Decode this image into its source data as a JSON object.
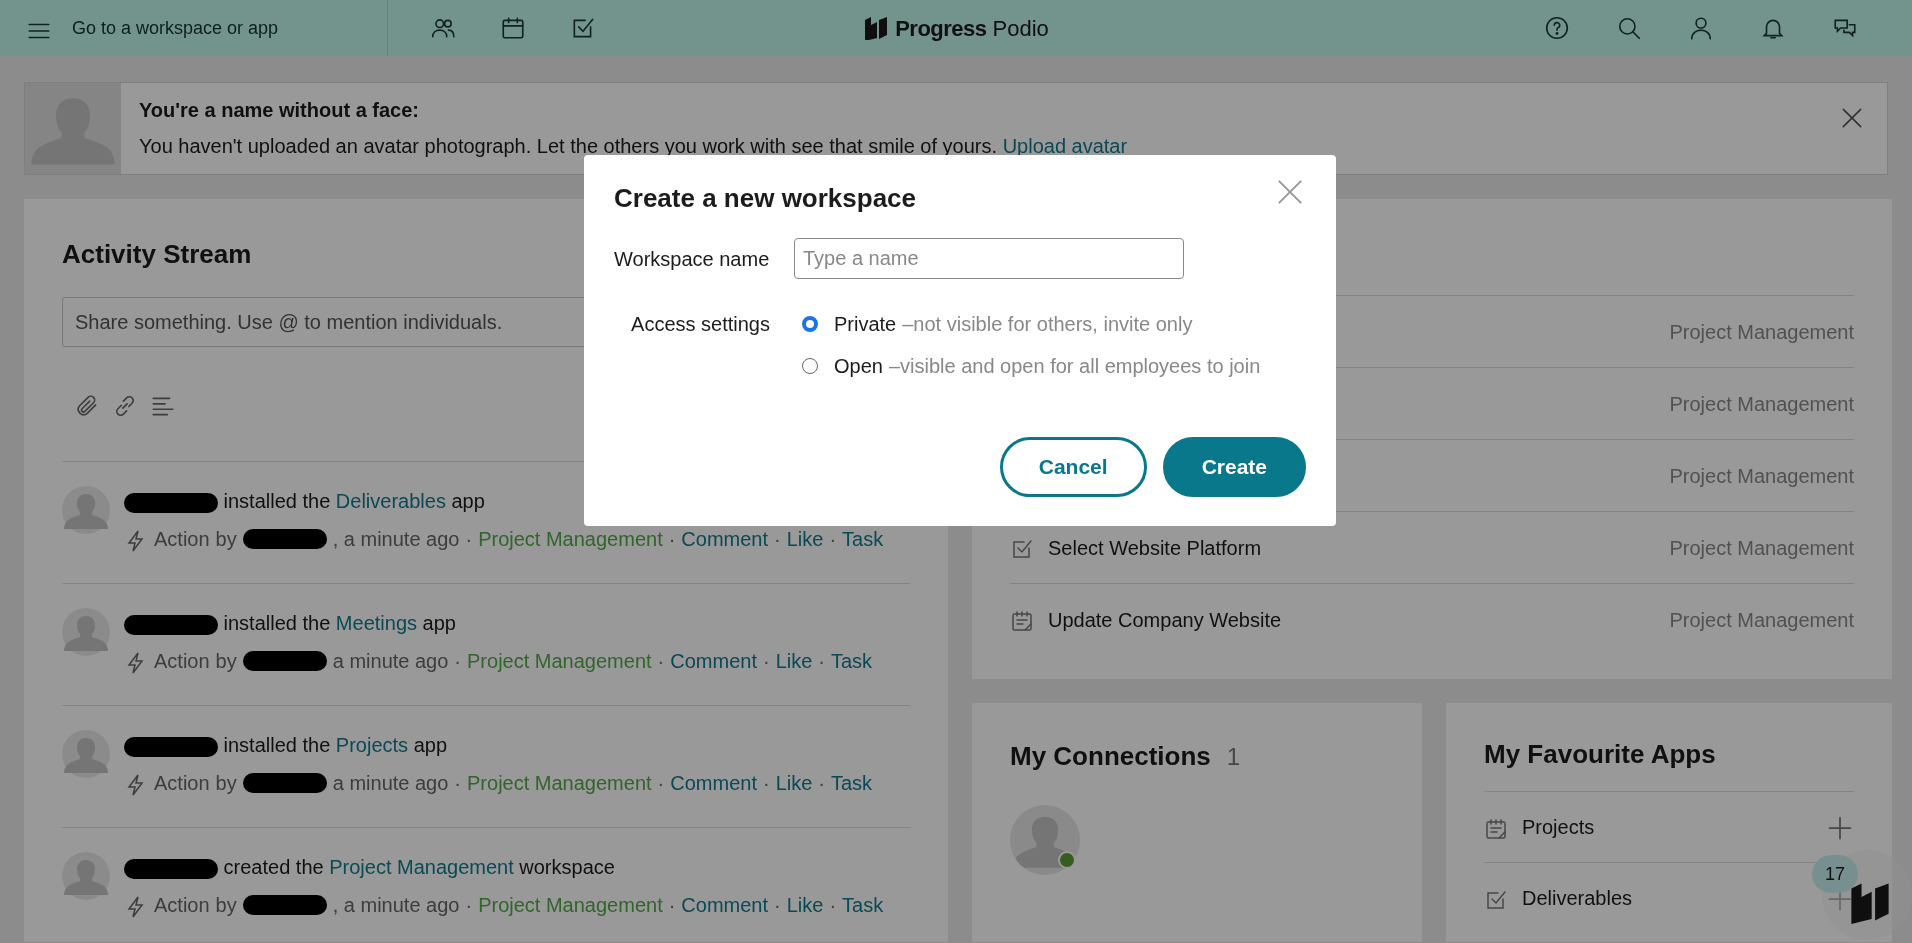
{
  "topbar": {
    "search_label": "Go to a workspace or app",
    "logo": {
      "brand": "Progress",
      "product": "Podio"
    }
  },
  "banner": {
    "title": "You're a name without a face:",
    "text": "You haven't uploaded an avatar photograph. Let the others you work with see that smile of yours.",
    "link": "Upload avatar"
  },
  "activity": {
    "title": "Activity Stream",
    "share_placeholder": "Share something. Use @ to mention individuals.",
    "items": [
      {
        "verb": "installed the",
        "target": "Deliverables",
        "suffix": "app",
        "meta": [
          {
            "kind": "label",
            "text": "Action"
          },
          {
            "kind": "label",
            "text": "by"
          },
          {
            "kind": "redaction"
          },
          {
            "kind": "label",
            "text": ", a minute ago"
          },
          {
            "kind": "sep",
            "text": "·"
          },
          {
            "kind": "workspace",
            "text": "Project Management"
          },
          {
            "kind": "sep",
            "text": "·"
          },
          {
            "kind": "link",
            "text": "Comment"
          },
          {
            "kind": "sep",
            "text": "·"
          },
          {
            "kind": "link",
            "text": "Like"
          },
          {
            "kind": "sep",
            "text": "·"
          },
          {
            "kind": "link",
            "text": "Task"
          }
        ]
      },
      {
        "verb": "installed the",
        "target": "Meetings",
        "suffix": "app",
        "meta": [
          {
            "kind": "label",
            "text": "Action"
          },
          {
            "kind": "label",
            "text": "by"
          },
          {
            "kind": "redaction"
          },
          {
            "kind": "label",
            "text": "a minute ago"
          },
          {
            "kind": "sep",
            "text": "·"
          },
          {
            "kind": "workspace",
            "text": "Project Management"
          },
          {
            "kind": "sep",
            "text": "·"
          },
          {
            "kind": "link",
            "text": "Comment"
          },
          {
            "kind": "sep",
            "text": "·"
          },
          {
            "kind": "link",
            "text": "Like"
          },
          {
            "kind": "sep",
            "text": "·"
          },
          {
            "kind": "link",
            "text": "Task"
          }
        ]
      },
      {
        "verb": "installed the",
        "target": "Projects",
        "suffix": "app",
        "meta": [
          {
            "kind": "label",
            "text": "Action"
          },
          {
            "kind": "label",
            "text": "by"
          },
          {
            "kind": "redaction"
          },
          {
            "kind": "label",
            "text": "a minute ago"
          },
          {
            "kind": "sep",
            "text": "·"
          },
          {
            "kind": "workspace",
            "text": "Project Management"
          },
          {
            "kind": "sep",
            "text": "·"
          },
          {
            "kind": "link",
            "text": "Comment"
          },
          {
            "kind": "sep",
            "text": "·"
          },
          {
            "kind": "link",
            "text": "Like"
          },
          {
            "kind": "sep",
            "text": "·"
          },
          {
            "kind": "link",
            "text": "Task"
          }
        ]
      },
      {
        "verb": "created the",
        "target": "Project Management",
        "suffix": "workspace",
        "meta": [
          {
            "kind": "label",
            "text": "Action"
          },
          {
            "kind": "label",
            "text": "by"
          },
          {
            "kind": "redaction"
          },
          {
            "kind": "label",
            "text": ", a minute ago"
          },
          {
            "kind": "sep",
            "text": "·"
          },
          {
            "kind": "workspace",
            "text": "Project Management"
          },
          {
            "kind": "sep",
            "text": "·"
          },
          {
            "kind": "link",
            "text": "Comment"
          },
          {
            "kind": "sep",
            "text": "·"
          },
          {
            "kind": "link",
            "text": "Like"
          },
          {
            "kind": "sep",
            "text": "·"
          },
          {
            "kind": "link",
            "text": "Task"
          }
        ]
      }
    ]
  },
  "tasks": [
    {
      "workspace": "Project Management"
    },
    {
      "workspace": "Project Management"
    },
    {
      "workspace": "Project Management"
    },
    {
      "kind": "check",
      "title": "Select Website Platform",
      "workspace": "Project Management"
    },
    {
      "kind": "note",
      "title": "Update Company Website",
      "workspace": "Project Management"
    }
  ],
  "connections": {
    "title": "My Connections",
    "count": "1",
    "people": [
      {
        "online": true
      }
    ]
  },
  "favourite_apps": {
    "title": "My Favourite Apps",
    "apps": [
      {
        "kind": "note",
        "name": "Projects"
      },
      {
        "kind": "check",
        "name": "Deliverables"
      }
    ]
  },
  "chat": {
    "badge": "17"
  },
  "dialog": {
    "title": "Create a new workspace",
    "name_label": "Workspace name",
    "name_placeholder": "Type a name",
    "access_label": "Access settings",
    "options": [
      {
        "label": "Private",
        "hint": "–not visible for others, invite only",
        "selected": true
      },
      {
        "label": "Open",
        "hint": "–visible and open for all employees to join",
        "selected": false
      }
    ],
    "buttons": [
      {
        "kind": "secondary",
        "label": "Cancel"
      },
      {
        "kind": "primary",
        "label": "Create"
      }
    ]
  }
}
